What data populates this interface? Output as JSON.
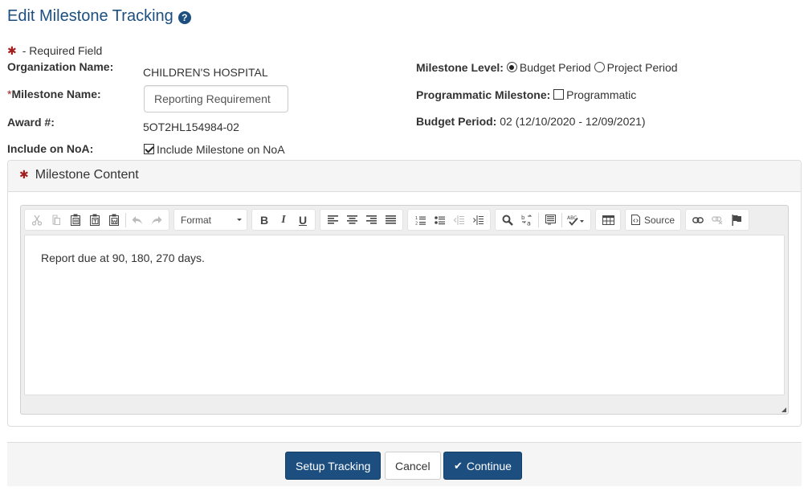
{
  "page": {
    "title": "Edit Milestone Tracking",
    "help_icon": "question-circle-icon",
    "required_note": "- Required Field"
  },
  "form": {
    "organization_label": "Organization Name:",
    "organization_value": "CHILDREN'S HOSPITAL",
    "milestone_name_label": "Milestone Name:",
    "milestone_name_value": "Reporting Requirement",
    "award_label": "Award #:",
    "award_value": "5OT2HL154984-02",
    "include_noa_label": "Include on NoA:",
    "include_noa_option": "Include Milestone on NoA",
    "include_noa_checked": true,
    "milestone_level_label": "Milestone Level:",
    "milestone_level_options": [
      "Budget Period",
      "Project Period"
    ],
    "milestone_level_selected": "Budget Period",
    "programmatic_label": "Programmatic Milestone:",
    "programmatic_option": "Programmatic",
    "programmatic_checked": false,
    "budget_period_label": "Budget Period:",
    "budget_period_value": "02 (12/10/2020 - 12/09/2021)"
  },
  "content_panel": {
    "heading": "Milestone Content",
    "editor": {
      "toolbar": {
        "format_label": "Format",
        "source_label": "Source",
        "icons": [
          "cut-icon",
          "copy-icon",
          "paste-icon",
          "paste-text-icon",
          "paste-word-icon",
          "undo-icon",
          "redo-icon",
          "bold-icon",
          "italic-icon",
          "underline-icon",
          "align-left-icon",
          "align-center-icon",
          "align-right-icon",
          "justify-icon",
          "numbered-list-icon",
          "bulleted-list-icon",
          "outdent-icon",
          "indent-icon",
          "find-icon",
          "replace-icon",
          "select-all-icon",
          "spellcheck-icon",
          "table-icon",
          "source-icon",
          "link-icon",
          "unlink-icon",
          "anchor-icon"
        ],
        "bold_glyph": "B",
        "italic_glyph": "I",
        "underline_glyph": "U"
      },
      "body_text": "Report due at 90, 180, 270 days."
    }
  },
  "footer": {
    "setup_tracking_label": "Setup Tracking",
    "cancel_label": "Cancel",
    "continue_label": "Continue",
    "continue_glyph": "✔"
  },
  "colors": {
    "primary": "#1c4f80",
    "required": "#a41d1d"
  }
}
